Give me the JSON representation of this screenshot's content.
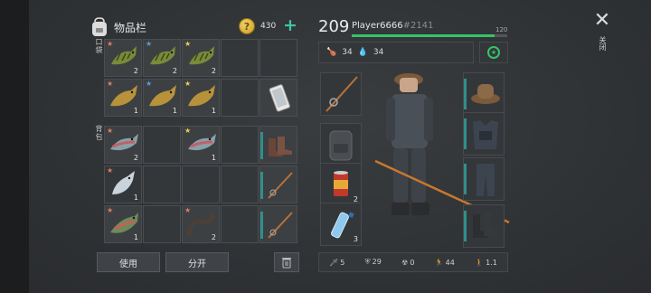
{
  "inventory": {
    "title": "物品栏",
    "coins": "430",
    "add_icon": "plus-icon",
    "section_pocket": "口袋",
    "section_backpack": "背包",
    "use_label": "使用",
    "split_label": "分开"
  },
  "character": {
    "level": "209",
    "name": "Player6666",
    "id": "#2141",
    "xp_max": "120",
    "xp_progress": 0.92,
    "food": "34",
    "water": "34",
    "quantities": {
      "backpack_slot": "",
      "can": "2",
      "bottle": "3"
    },
    "stats": [
      "5",
      "29",
      "0",
      "44",
      "1.1"
    ]
  },
  "pocket_items": [
    {
      "qty": "2",
      "star_color": "#e07a5f"
    },
    {
      "qty": "2",
      "star_color": "#5b9bd5"
    },
    {
      "qty": "2",
      "star_color": "#f2c94c"
    },
    {
      "qty": "1",
      "star_color": "#e07a5f"
    },
    {
      "qty": "1",
      "star_color": "#5b9bd5"
    },
    {
      "qty": "1",
      "star_color": "#f2c94c"
    }
  ],
  "backpack_items": [
    {
      "qty": "2",
      "star_color": "#e07a5f"
    },
    {
      "qty": "1",
      "star_color": "#f2c94c"
    },
    {
      "qty": "1",
      "star_color": "#e07a5f"
    },
    {
      "qty": "1",
      "star_color": "#e07a5f"
    },
    {
      "qty": "2",
      "star_color": "#e07a5f"
    }
  ],
  "close_label": "关闭",
  "colors": {
    "accent": "#3ec6a4",
    "xp": "#35c46a",
    "tag": "#2f8f8a"
  }
}
